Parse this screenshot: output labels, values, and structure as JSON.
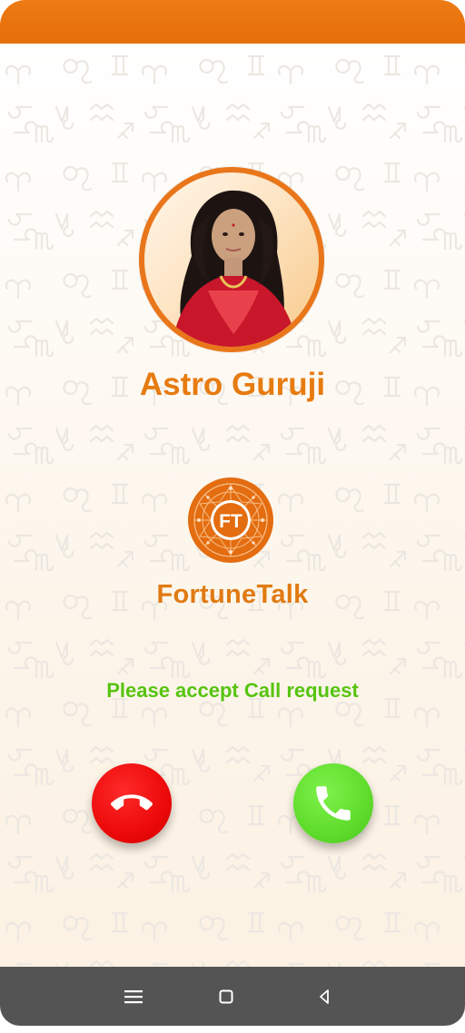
{
  "caller": {
    "name": "Astro Guruji",
    "avatar_icon": "astrologer-portrait"
  },
  "brand": {
    "logo_initials": "FT",
    "name": "FortuneTalk",
    "logo_icon": "zodiac-wheel-logo"
  },
  "call": {
    "prompt": "Please accept Call request",
    "decline_icon": "phone-hangup-icon",
    "accept_icon": "phone-icon"
  },
  "nav": {
    "menu_icon": "menu-icon",
    "home_icon": "home-square-icon",
    "back_icon": "back-triangle-icon"
  },
  "colors": {
    "accent_orange": "#e9761a",
    "prompt_green": "#56c40f",
    "decline_red": "#ec0a0a",
    "accept_green": "#5fdc2c",
    "nav_bar": "#545454"
  }
}
